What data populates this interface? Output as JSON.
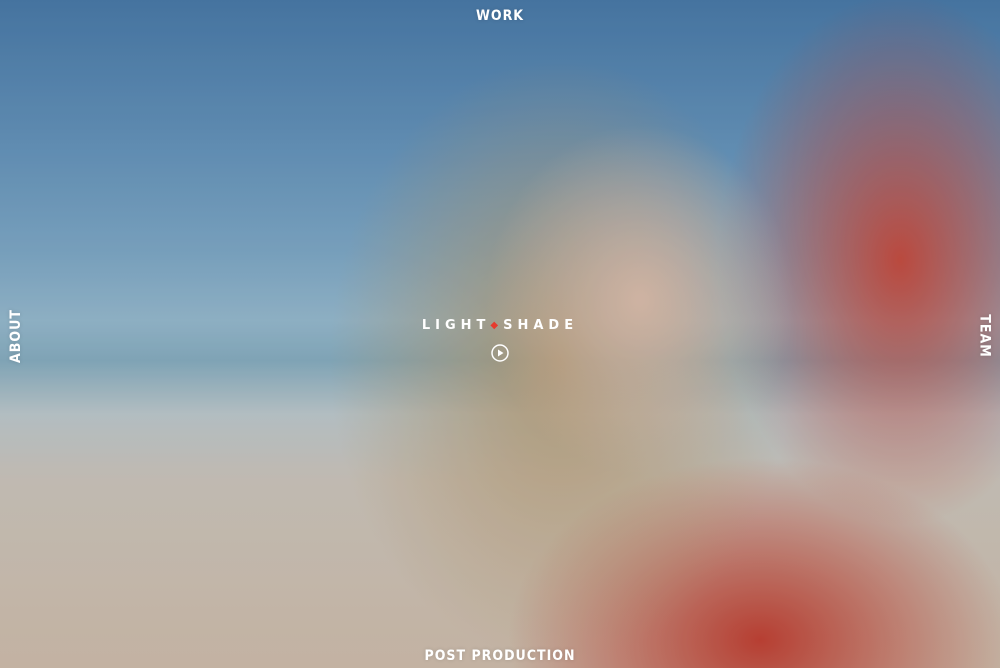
{
  "nav": {
    "top": "WORK",
    "left": "ABOUT",
    "right": "TEAM",
    "bottom": "POST PRODUCTION"
  },
  "logo": {
    "part1": "LIGHT",
    "separator": "◆",
    "part2": "SHADE"
  },
  "icons": {
    "play": "play-circle-icon"
  },
  "colors": {
    "nav_text": "#ffffff",
    "logo_accent": "#e63b2e"
  }
}
